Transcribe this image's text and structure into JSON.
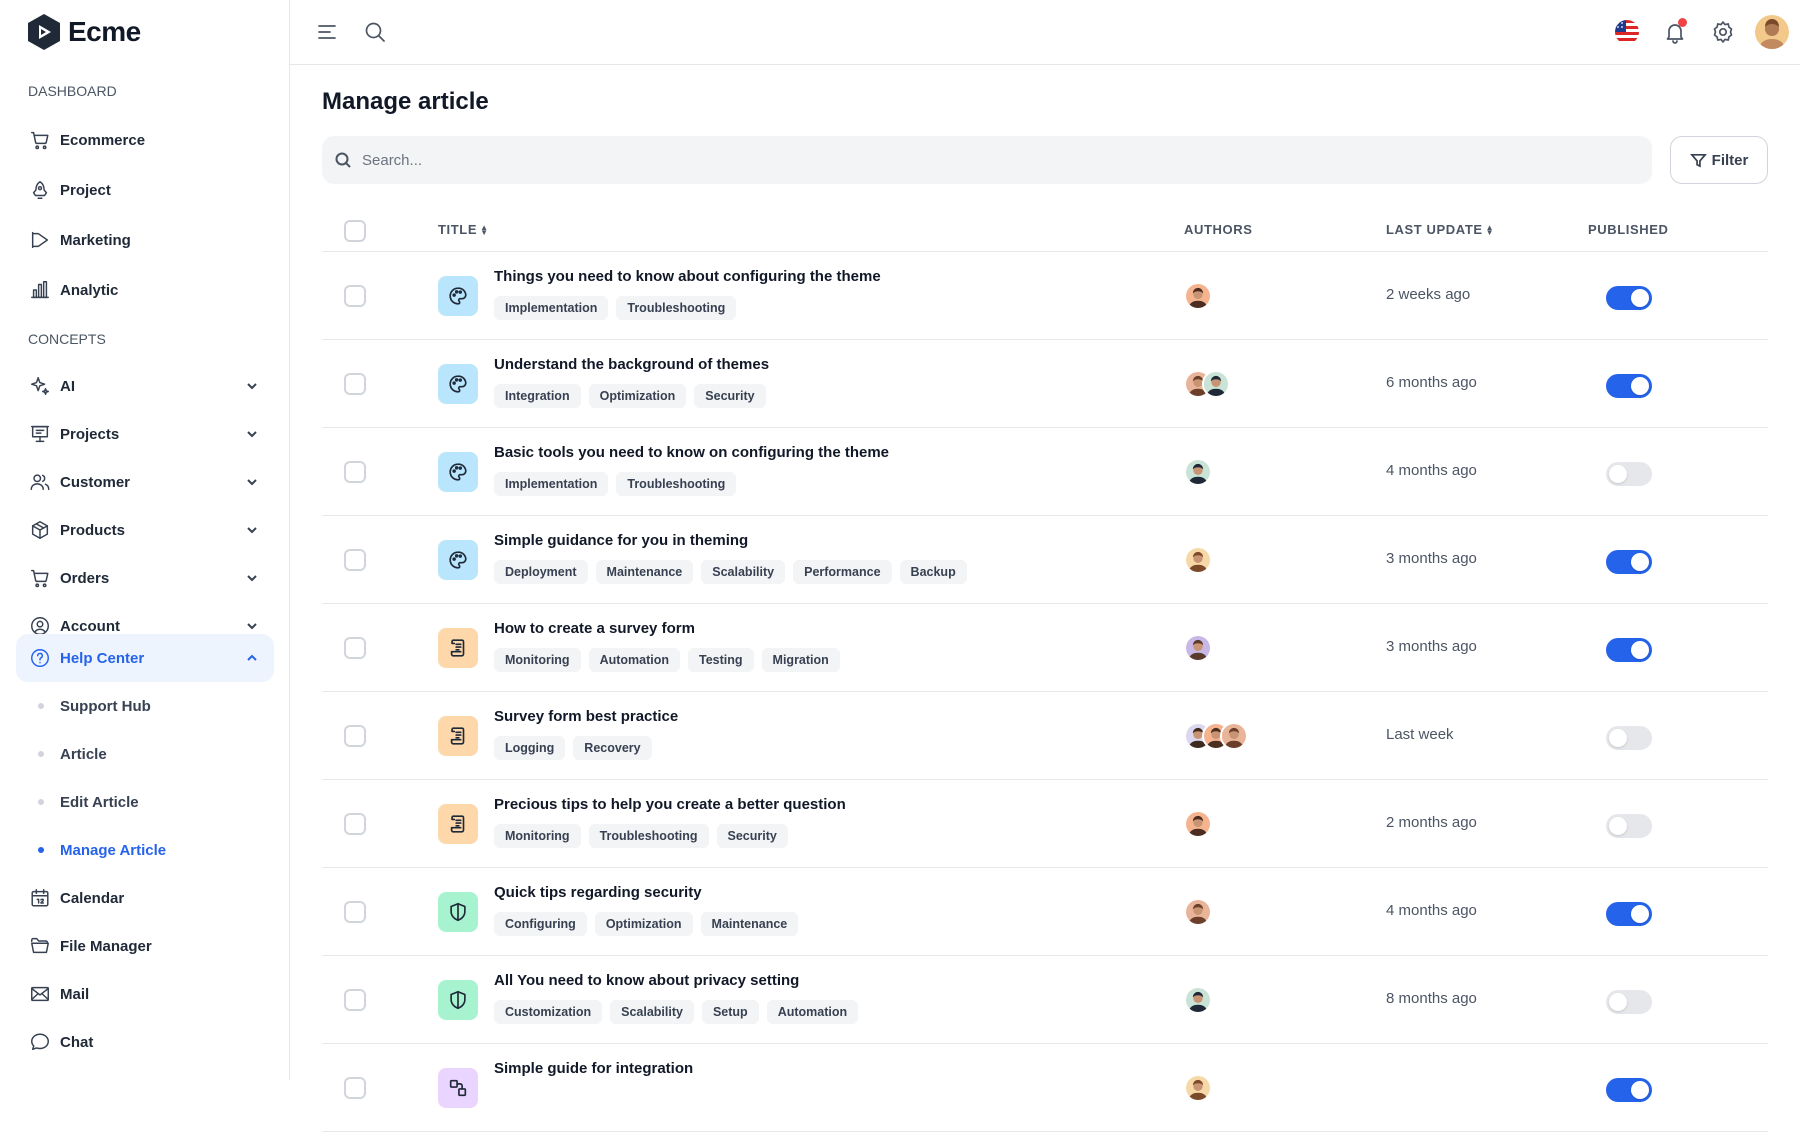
{
  "app": {
    "name": "Ecme"
  },
  "sidebar": {
    "dashboard_title": "DASHBOARD",
    "dashboard_items": [
      {
        "label": "Ecommerce",
        "icon": "cart-icon"
      },
      {
        "label": "Project",
        "icon": "rocket-icon"
      },
      {
        "label": "Marketing",
        "icon": "megaphone-icon"
      },
      {
        "label": "Analytic",
        "icon": "bar-chart-icon"
      }
    ],
    "concepts_title": "CONCEPTS",
    "concept_items": [
      {
        "label": "AI",
        "icon": "sparkle-icon"
      },
      {
        "label": "Projects",
        "icon": "presentation-icon"
      },
      {
        "label": "Customer",
        "icon": "users-icon"
      },
      {
        "label": "Products",
        "icon": "box-icon"
      },
      {
        "label": "Orders",
        "icon": "cart-icon"
      },
      {
        "label": "Account",
        "icon": "user-circle-icon"
      },
      {
        "label": "Help Center",
        "icon": "help-icon"
      }
    ],
    "help_sub_items": [
      {
        "label": "Support Hub"
      },
      {
        "label": "Article"
      },
      {
        "label": "Edit Article"
      },
      {
        "label": "Manage Article"
      }
    ],
    "bottom_items": [
      {
        "label": "Calendar",
        "icon": "calendar-icon"
      },
      {
        "label": "File Manager",
        "icon": "folder-icon"
      },
      {
        "label": "Mail",
        "icon": "mail-icon"
      },
      {
        "label": "Chat",
        "icon": "chat-icon"
      }
    ]
  },
  "page": {
    "title": "Manage article",
    "search_placeholder": "Search...",
    "filter_label": "Filter"
  },
  "table": {
    "columns": {
      "title": "TITLE",
      "authors": "AUTHORS",
      "last_update": "LAST UPDATE",
      "published": "PUBLISHED"
    },
    "rows": [
      {
        "title": "Things you need to know about configuring the theme",
        "category": "theme",
        "tags": [
          "Implementation",
          "Troubleshooting"
        ],
        "authors": 1,
        "updated": "2 weeks ago",
        "published": true
      },
      {
        "title": "Understand the background of themes",
        "category": "theme",
        "tags": [
          "Integration",
          "Optimization",
          "Security"
        ],
        "authors": 2,
        "updated": "6 months ago",
        "published": true
      },
      {
        "title": "Basic tools you need to know on configuring the theme",
        "category": "theme",
        "tags": [
          "Implementation",
          "Troubleshooting"
        ],
        "authors": 1,
        "updated": "4 months ago",
        "published": false
      },
      {
        "title": "Simple guidance for you in theming",
        "category": "theme",
        "tags": [
          "Deployment",
          "Maintenance",
          "Scalability",
          "Performance",
          "Backup"
        ],
        "authors": 1,
        "updated": "3 months ago",
        "published": true
      },
      {
        "title": "How to create a survey form",
        "category": "survey",
        "tags": [
          "Monitoring",
          "Automation",
          "Testing",
          "Migration"
        ],
        "authors": 1,
        "updated": "3 months ago",
        "published": true
      },
      {
        "title": "Survey form best practice",
        "category": "survey",
        "tags": [
          "Logging",
          "Recovery"
        ],
        "authors": 3,
        "updated": "Last week",
        "published": false
      },
      {
        "title": "Precious tips to help you create a better question",
        "category": "survey",
        "tags": [
          "Monitoring",
          "Troubleshooting",
          "Security"
        ],
        "authors": 1,
        "updated": "2 months ago",
        "published": false
      },
      {
        "title": "Quick tips regarding security",
        "category": "security",
        "tags": [
          "Configuring",
          "Optimization",
          "Maintenance"
        ],
        "authors": 1,
        "updated": "4 months ago",
        "published": true
      },
      {
        "title": "All You need to know about privacy setting",
        "category": "security",
        "tags": [
          "Customization",
          "Scalability",
          "Setup",
          "Automation"
        ],
        "authors": 1,
        "updated": "8 months ago",
        "published": false
      },
      {
        "title": "Simple guide for integration",
        "category": "integration",
        "tags": [],
        "authors": 1,
        "updated": "",
        "published": true
      }
    ]
  },
  "colors": {
    "accent": "#2563eb",
    "theme_icon_bg": "#bae6fd",
    "survey_icon_bg": "#fed7aa",
    "security_icon_bg": "#a7f3d0",
    "integration_icon_bg": "#e9d5ff"
  }
}
